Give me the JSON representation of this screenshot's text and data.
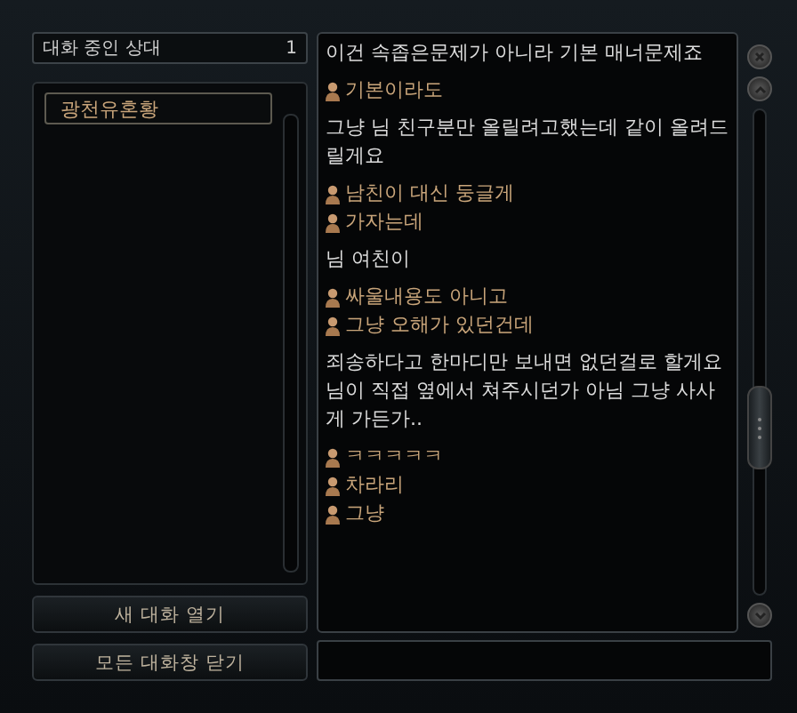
{
  "contacts_header": {
    "label": "대화 중인 상대",
    "count": "1"
  },
  "contacts": [
    {
      "name": "광천유혼황",
      "selected": false
    }
  ],
  "buttons": [
    "새 대화 열기",
    "모든 대화창 닫기"
  ],
  "messages": [
    {
      "kind": "self",
      "text": "이건 속좁은문제가 아니라 기본 매너문제죠"
    },
    {
      "kind": "other",
      "text": "기본이라도"
    },
    {
      "kind": "self",
      "text": "그냥 님 친구분만 올릴려고했는데 같이 올려드릴게요"
    },
    {
      "kind": "other",
      "text": "남친이 대신 둥글게"
    },
    {
      "kind": "other",
      "text": "가자는데"
    },
    {
      "kind": "self",
      "text": "님 여친이"
    },
    {
      "kind": "other",
      "text": "싸울내용도 아니고"
    },
    {
      "kind": "other",
      "text": "그냥 오해가 있던건데"
    },
    {
      "kind": "self",
      "text": "죄송하다고 한마디만 보내면 없던걸로 할게요"
    },
    {
      "kind": "self",
      "text": "님이 직접 옆에서 쳐주시던가 아님 그냥 사사게 가든가.."
    },
    {
      "kind": "other",
      "text": "ㅋㅋㅋㅋㅋ"
    },
    {
      "kind": "other",
      "text": "차라리"
    },
    {
      "kind": "other",
      "text": "그냥"
    }
  ]
}
